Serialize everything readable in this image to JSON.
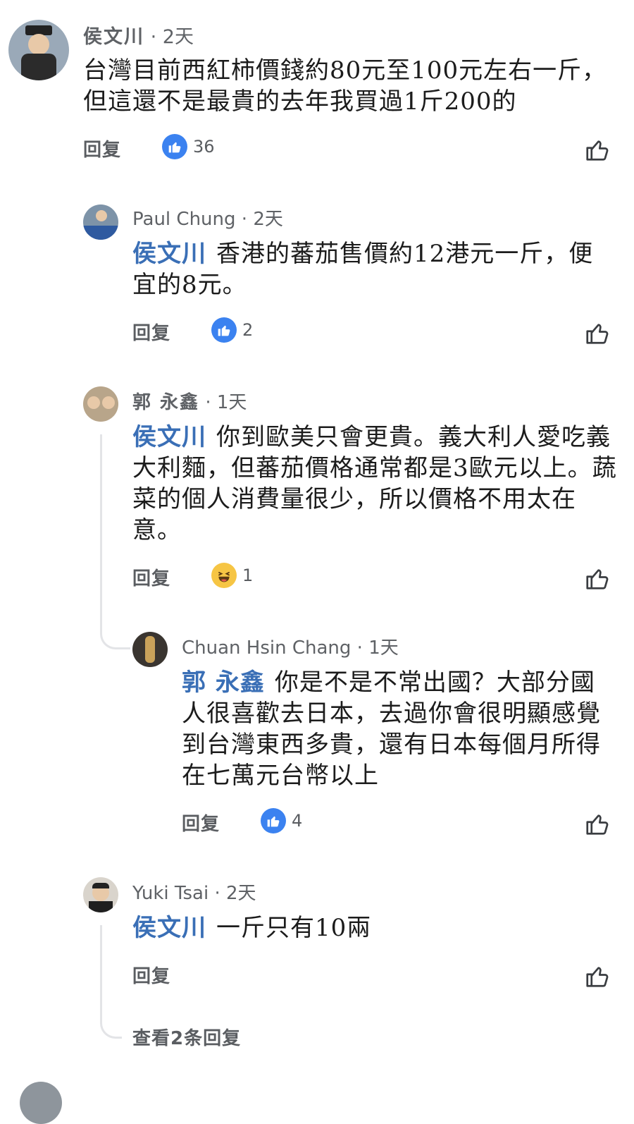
{
  "comments": [
    {
      "name": "侯文川",
      "time": "2天",
      "text": "台灣目前西紅柿價錢約80元至100元左右一斤，但這還不是最貴的去年我買過1斤200的",
      "reply_label": "回复",
      "reaction": {
        "type": "like",
        "count": "36"
      }
    },
    {
      "name": "Paul Chung",
      "time": "2天",
      "mention": "侯文川",
      "text": "香港的蕃茄售價約12港元一斤，便宜的8元。",
      "reply_label": "回复",
      "reaction": {
        "type": "like",
        "count": "2"
      }
    },
    {
      "name": "郭 永鑫",
      "time": "1天",
      "mention": "侯文川",
      "text": "你到歐美只會更貴。義大利人愛吃義大利麵，但蕃茄價格通常都是3歐元以上。蔬菜的個人消費量很少，所以價格不用太在意。",
      "reply_label": "回复",
      "reaction": {
        "type": "haha",
        "count": "1"
      }
    },
    {
      "name": "Chuan Hsin Chang",
      "time": "1天",
      "mention": "郭 永鑫",
      "text": "你是不是不常出國？大部分國人很喜歡去日本，去過你會很明顯感覺到台灣東西多貴，還有日本每個月所得在七萬元台幣以上",
      "reply_label": "回复",
      "reaction": {
        "type": "like",
        "count": "4"
      }
    },
    {
      "name": "Yuki Tsai",
      "time": "2天",
      "mention": "侯文川",
      "text": "一斤只有10兩",
      "reply_label": "回复"
    }
  ],
  "view_more_replies": "查看2条回复",
  "separator": "·",
  "colors": {
    "mention": "#3a6fb6",
    "like": "#3b82f0",
    "haha": "#f6c544",
    "thread_line": "#e3e4e7"
  }
}
